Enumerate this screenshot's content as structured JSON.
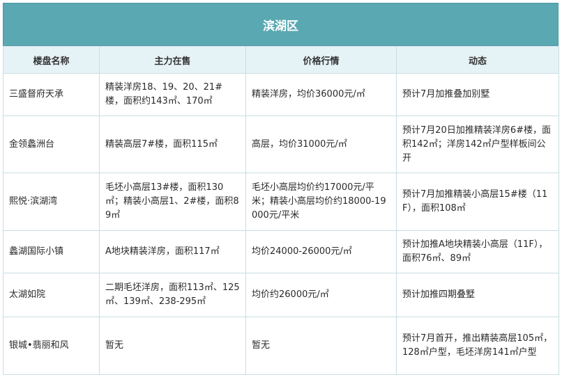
{
  "title": "滨湖区",
  "headers": {
    "name": "楼盘名称",
    "main_sale": "主力在售",
    "price": "价格行情",
    "news": "动态"
  },
  "rows": [
    {
      "name": "三盛督府天承",
      "main_sale": "精装洋房18、19、20、21#楼，面积约143㎡、170㎡",
      "price": "精装洋房，均价36000元/㎡",
      "news": "预计7月加推叠加别墅"
    },
    {
      "name": "金领蠡洲台",
      "main_sale": "精装高层7#楼，面积115㎡",
      "price": "高层，均价31000元/㎡",
      "news": "预计7月20日加推精装洋房6#楼，面积142㎡；洋房142㎡户型样板间公开"
    },
    {
      "name": "熙悦·滨湖湾",
      "main_sale": "毛坯小高层13#楼，面积130㎡；精装小高层1、2#楼，面积89㎡",
      "price": "毛坯小高层均价约17000元/平米；精装小高层均价约18000-19000元/平米",
      "news": "预计7月加推精装小高层15#楼（11F），面积108㎡"
    },
    {
      "name": "蠡湖国际小镇",
      "main_sale": "A地块精装洋房，面积117㎡",
      "price": "均价24000-26000元/㎡",
      "news": "预计加推A地块精装小高层（11F），面积76㎡、89㎡"
    },
    {
      "name": "太湖如院",
      "main_sale": "二期毛坯洋房，面积113㎡、125㎡、139㎡、238-295㎡",
      "price": "均价约26000元/㎡",
      "news": "预计加推四期叠墅"
    },
    {
      "name": "银城•翡丽和风",
      "main_sale": "暂无",
      "price": "暂无",
      "news": "预计7月首开，推出精装高层105㎡，128㎡户型，毛坯洋房141㎡户型"
    }
  ],
  "colors": {
    "title_bg": "#5aa8b2",
    "header_bg": "#e6f3f6",
    "border": "#c7dde2"
  }
}
